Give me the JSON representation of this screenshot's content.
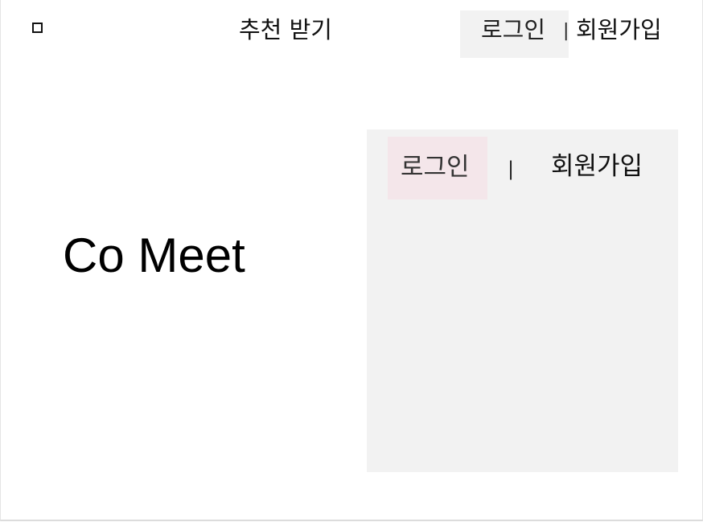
{
  "nav": {
    "logo_icon": "square-icon",
    "recommend_label": "추천 받기",
    "separator": "|",
    "login_label": "로그인",
    "signup_label": "회원가입"
  },
  "brand": {
    "title": "Co Meet"
  },
  "auth_panel": {
    "login_tab_label": "로그인",
    "separator": "|",
    "signup_tab_label": "회원가입",
    "active_tab_color": "#f4e6ea",
    "panel_color": "#f2f2f2"
  }
}
